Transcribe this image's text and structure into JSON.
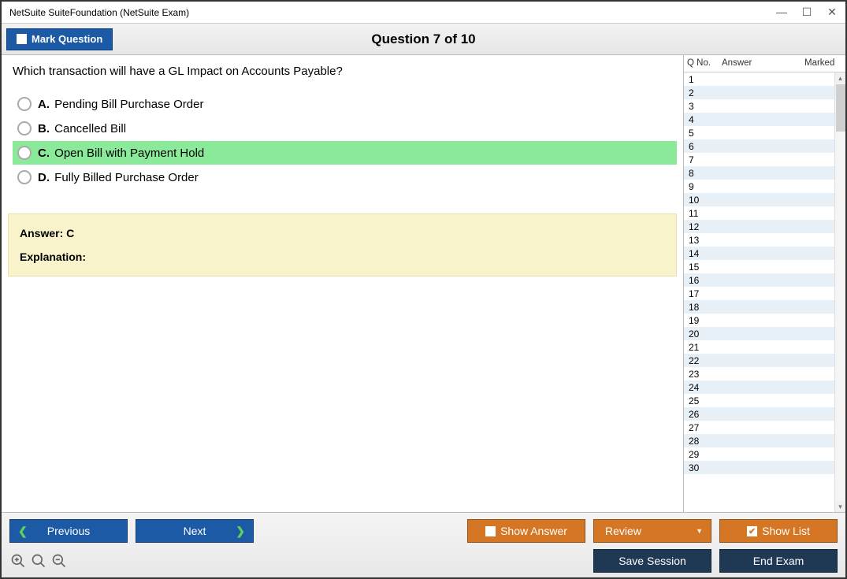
{
  "titlebar": {
    "text": "NetSuite SuiteFoundation (NetSuite Exam)"
  },
  "header": {
    "mark_label": "Mark Question",
    "question_title": "Question 7 of 10"
  },
  "question": {
    "text": "Which transaction will have a GL Impact on Accounts Payable?",
    "options": [
      {
        "letter": "A.",
        "text": "Pending Bill Purchase Order",
        "highlighted": false
      },
      {
        "letter": "B.",
        "text": "Cancelled Bill",
        "highlighted": false
      },
      {
        "letter": "C.",
        "text": "Open Bill with Payment Hold",
        "highlighted": true
      },
      {
        "letter": "D.",
        "text": "Fully Billed Purchase Order",
        "highlighted": false
      }
    ],
    "answer_label": "Answer:",
    "answer_value": "C",
    "explanation_label": "Explanation:"
  },
  "side": {
    "col_qno": "Q No.",
    "col_answer": "Answer",
    "col_marked": "Marked",
    "rows": [
      {
        "qno": "1",
        "answer": "",
        "marked": ""
      },
      {
        "qno": "2",
        "answer": "",
        "marked": ""
      },
      {
        "qno": "3",
        "answer": "",
        "marked": ""
      },
      {
        "qno": "4",
        "answer": "",
        "marked": ""
      },
      {
        "qno": "5",
        "answer": "",
        "marked": ""
      },
      {
        "qno": "6",
        "answer": "",
        "marked": ""
      },
      {
        "qno": "7",
        "answer": "",
        "marked": ""
      },
      {
        "qno": "8",
        "answer": "",
        "marked": ""
      },
      {
        "qno": "9",
        "answer": "",
        "marked": ""
      },
      {
        "qno": "10",
        "answer": "",
        "marked": ""
      },
      {
        "qno": "11",
        "answer": "",
        "marked": ""
      },
      {
        "qno": "12",
        "answer": "",
        "marked": ""
      },
      {
        "qno": "13",
        "answer": "",
        "marked": ""
      },
      {
        "qno": "14",
        "answer": "",
        "marked": ""
      },
      {
        "qno": "15",
        "answer": "",
        "marked": ""
      },
      {
        "qno": "16",
        "answer": "",
        "marked": ""
      },
      {
        "qno": "17",
        "answer": "",
        "marked": ""
      },
      {
        "qno": "18",
        "answer": "",
        "marked": ""
      },
      {
        "qno": "19",
        "answer": "",
        "marked": ""
      },
      {
        "qno": "20",
        "answer": "",
        "marked": ""
      },
      {
        "qno": "21",
        "answer": "",
        "marked": ""
      },
      {
        "qno": "22",
        "answer": "",
        "marked": ""
      },
      {
        "qno": "23",
        "answer": "",
        "marked": ""
      },
      {
        "qno": "24",
        "answer": "",
        "marked": ""
      },
      {
        "qno": "25",
        "answer": "",
        "marked": ""
      },
      {
        "qno": "26",
        "answer": "",
        "marked": ""
      },
      {
        "qno": "27",
        "answer": "",
        "marked": ""
      },
      {
        "qno": "28",
        "answer": "",
        "marked": ""
      },
      {
        "qno": "29",
        "answer": "",
        "marked": ""
      },
      {
        "qno": "30",
        "answer": "",
        "marked": ""
      }
    ]
  },
  "footer": {
    "previous": "Previous",
    "next": "Next",
    "show_answer": "Show Answer",
    "review": "Review",
    "show_list": "Show List",
    "save_session": "Save Session",
    "end_exam": "End Exam"
  }
}
